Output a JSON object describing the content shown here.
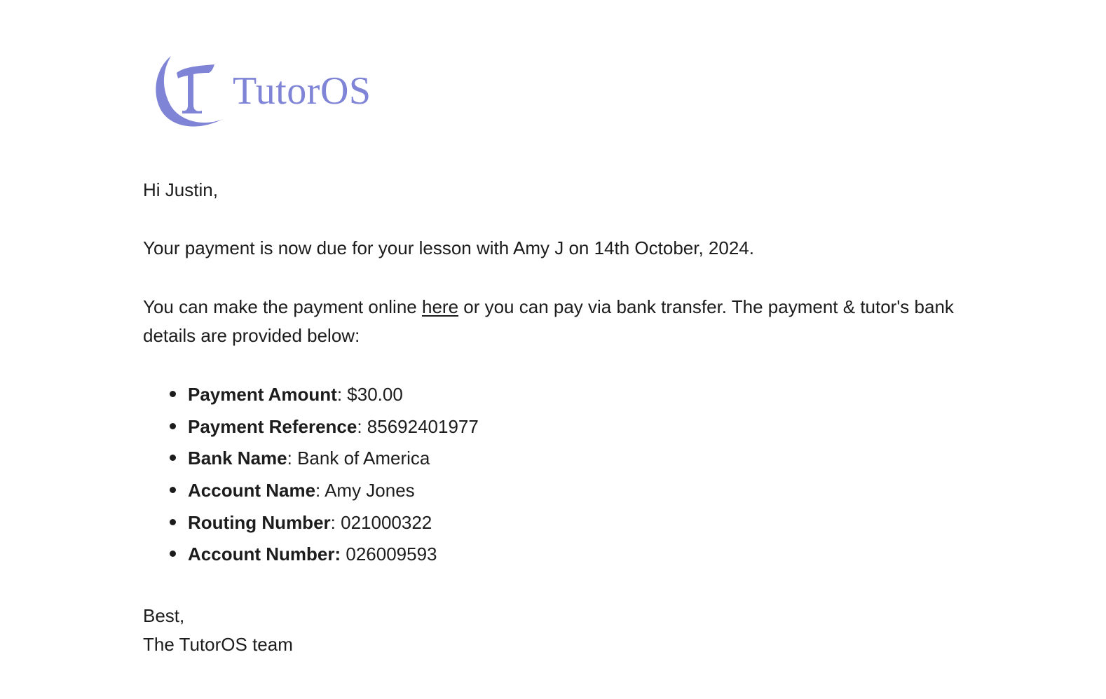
{
  "brand": {
    "name": "TutorOS",
    "logo_icon": "tutoros-crescent-t-logo",
    "color": "#7f84d6"
  },
  "email": {
    "greeting": "Hi Justin,",
    "due_text": "Your payment is now due for your lesson with Amy J on 14th October, 2024.",
    "pay_before_link": "You can make the payment online ",
    "pay_link_text": "here",
    "pay_after_link": " or you can pay via bank transfer. The payment & tutor's bank details are provided below:",
    "details": [
      {
        "label": "Payment Amount",
        "sep": ": ",
        "value": "$30.00"
      },
      {
        "label": "Payment Reference",
        "sep": ": ",
        "value": "85692401977"
      },
      {
        "label": "Bank Name",
        "sep": ": ",
        "value": "Bank of America"
      },
      {
        "label": "Account Name",
        "sep": ": ",
        "value": "Amy Jones"
      },
      {
        "label": "Routing Number",
        "sep": ": ",
        "value": "021000322"
      },
      {
        "label": "Account Number:",
        "sep": " ",
        "value": "026009593"
      }
    ],
    "signoff": "Best,",
    "team": "The TutorOS team"
  }
}
